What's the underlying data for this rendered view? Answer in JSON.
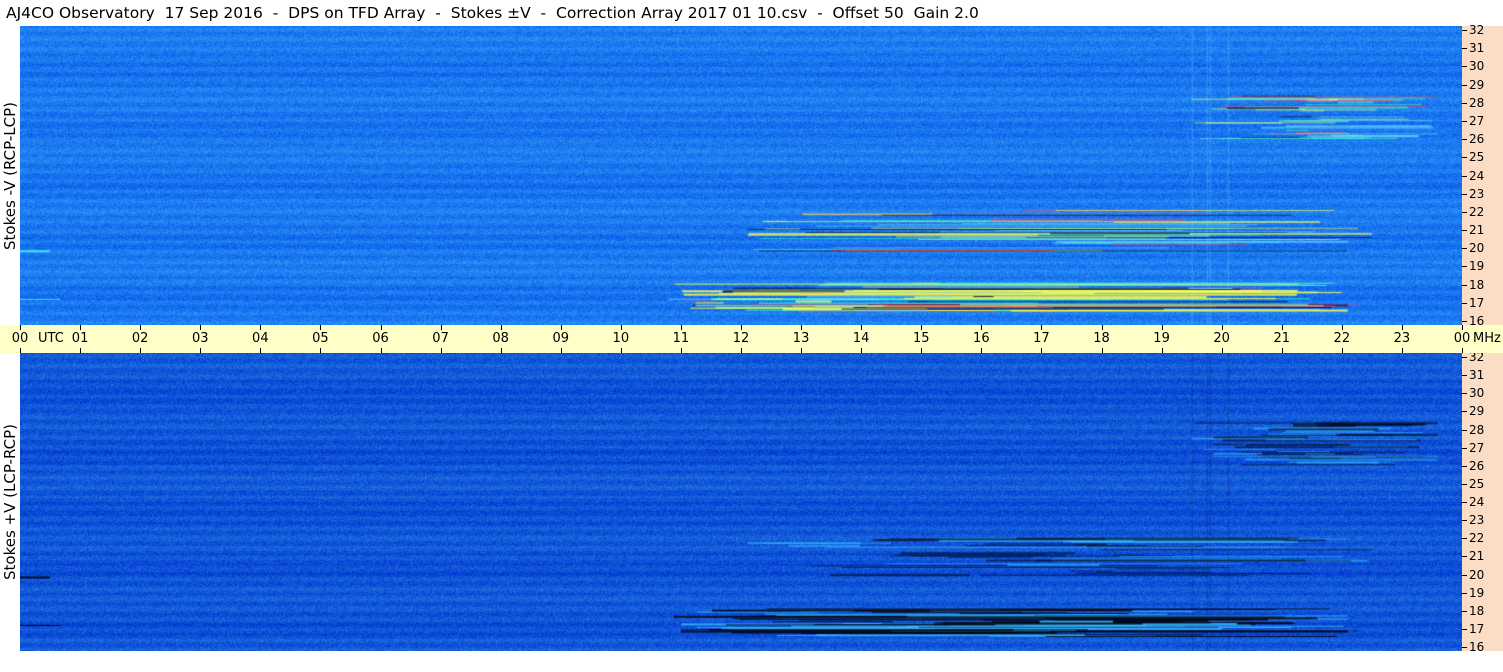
{
  "title": "AJ4CO Observatory  17 Sep 2016  -  DPS on TFD Array  -  Stokes ±V  -  Correction Array 2017 01 10.csv  -  Offset 50  Gain 2.0",
  "time_axis": {
    "unit_label": "UTC",
    "freq_unit_label": "MHz",
    "hours": [
      "00",
      "01",
      "02",
      "03",
      "04",
      "05",
      "06",
      "07",
      "08",
      "09",
      "10",
      "11",
      "12",
      "13",
      "14",
      "15",
      "16",
      "17",
      "18",
      "19",
      "20",
      "21",
      "22",
      "23",
      "00"
    ]
  },
  "frequency_ticks": [
    "32",
    "31",
    "30",
    "29",
    "28",
    "27",
    "26",
    "25",
    "24",
    "23",
    "22",
    "21",
    "20",
    "19",
    "18",
    "17",
    "16"
  ],
  "panels": [
    {
      "id": "top",
      "ylabel": "Stokes -V (RCP-LCP)"
    },
    {
      "id": "bottom",
      "ylabel": "Stokes +V (LCP-RCP)"
    }
  ],
  "chart_data": {
    "type": "heatmap",
    "title": "AJ4CO Observatory  17 Sep 2016  -  DPS on TFD Array  -  Stokes ±V  -  Correction Array 2017 01 10.csv  -  Offset 50  Gain 2.0",
    "x_axis": {
      "label": "UTC",
      "range": [
        0,
        24
      ],
      "unit": "hours"
    },
    "y_axis": {
      "label": "MHz",
      "range": [
        16,
        32
      ]
    },
    "panels": [
      {
        "name": "Stokes -V (RCP-LCP)",
        "background_color": "#1a78f0",
        "events": [
          {
            "t_start": 10.7,
            "t_end": 22.1,
            "f_low": 16.8,
            "f_high": 18.3,
            "description": "strong emission band"
          },
          {
            "t_start": 12.0,
            "t_end": 22.5,
            "f_low": 19.9,
            "f_high": 22.2,
            "description": "narrowband streaks"
          },
          {
            "t_start": 19.5,
            "t_end": 23.6,
            "f_low": 26.0,
            "f_high": 28.3,
            "description": "streaks"
          }
        ]
      },
      {
        "name": "Stokes +V (LCP-RCP)",
        "background_color": "#1055d8",
        "events": [
          {
            "t_start": 10.7,
            "t_end": 22.1,
            "f_low": 16.8,
            "f_high": 18.3,
            "description": "strong emission band"
          },
          {
            "t_start": 12.0,
            "t_end": 22.5,
            "f_low": 19.9,
            "f_high": 22.2,
            "description": "narrowband streaks"
          },
          {
            "t_start": 19.5,
            "t_end": 23.6,
            "f_low": 26.0,
            "f_high": 28.3,
            "description": "streaks"
          }
        ]
      }
    ]
  }
}
